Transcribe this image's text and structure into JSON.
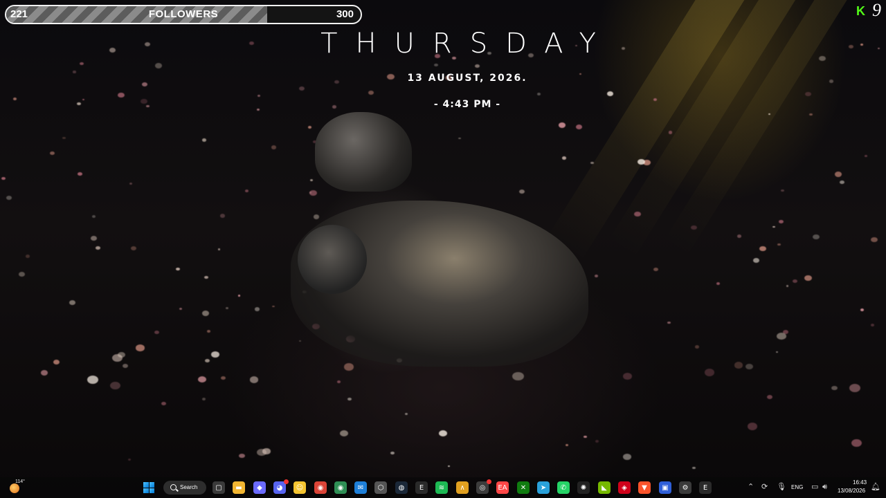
{
  "stream_overlay": {
    "follower_goal": {
      "current": "221",
      "label": "FOLLOWERS",
      "goal": "300",
      "progress_fraction": 0.737
    },
    "kick": {
      "logo_text": "K",
      "count": "9",
      "brand_color": "#53fc18"
    }
  },
  "clock_widget": {
    "day": "THURSDAY",
    "date": "13 AUGUST, 2026.",
    "time": "- 4:43 PM -"
  },
  "taskbar": {
    "weather": {
      "icon": "sun-icon",
      "temperature": "114°"
    },
    "start_icon": "windows-icon",
    "search_label": "Search",
    "pinned_apps": [
      {
        "name": "task-view",
        "glyph": "▢",
        "color": "#3a3a3a"
      },
      {
        "name": "file-explorer",
        "glyph": "▬",
        "color": "#f2b632"
      },
      {
        "name": "copilot",
        "glyph": "◆",
        "color": "#6b6bff"
      },
      {
        "name": "discord",
        "glyph": "◕",
        "color": "#5865f2"
      },
      {
        "name": "emoji-app",
        "glyph": "☺",
        "color": "#f4c430"
      },
      {
        "name": "chrome",
        "glyph": "◉",
        "color": "#db4437"
      },
      {
        "name": "chrome-dev",
        "glyph": "◉",
        "color": "#2f8f55"
      },
      {
        "name": "mail",
        "glyph": "✉",
        "color": "#1e7fd8"
      },
      {
        "name": "unity",
        "glyph": "⬡",
        "color": "#555555"
      },
      {
        "name": "steam",
        "glyph": "◍",
        "color": "#1b2838"
      },
      {
        "name": "epic-games",
        "glyph": "E",
        "color": "#2a2a2a"
      },
      {
        "name": "spotify",
        "glyph": "≋",
        "color": "#1db954"
      },
      {
        "name": "arc",
        "glyph": "∧",
        "color": "#e0a020"
      },
      {
        "name": "obs",
        "glyph": "◎",
        "color": "#3c3c3c"
      },
      {
        "name": "ea-app",
        "glyph": "EA",
        "color": "#ff4747"
      },
      {
        "name": "xbox",
        "glyph": "✕",
        "color": "#107c10"
      },
      {
        "name": "telegram",
        "glyph": "➤",
        "color": "#2aa1da"
      },
      {
        "name": "whatsapp",
        "glyph": "✆",
        "color": "#25d366"
      },
      {
        "name": "openai",
        "glyph": "✺",
        "color": "#222222"
      },
      {
        "name": "nvidia",
        "glyph": "◣",
        "color": "#76b900"
      },
      {
        "name": "amd-adrenalin",
        "glyph": "◈",
        "color": "#d0021b"
      },
      {
        "name": "brave",
        "glyph": "▼",
        "color": "#fb542b"
      },
      {
        "name": "vm-app",
        "glyph": "▣",
        "color": "#2f5fd8"
      },
      {
        "name": "settings",
        "glyph": "⚙",
        "color": "#3a3a3a"
      },
      {
        "name": "epic-launcher",
        "glyph": "E",
        "color": "#2a2a2a"
      }
    ],
    "tray": {
      "language": "ENG",
      "time": "16:43",
      "date": "13/08/2026"
    }
  }
}
